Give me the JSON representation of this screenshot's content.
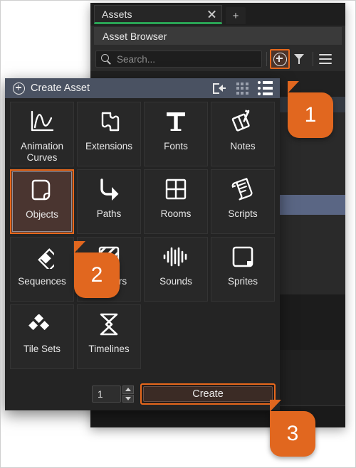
{
  "browser": {
    "tab": {
      "label": "Assets",
      "close_icon": "close-icon",
      "add_tab_label": "+"
    },
    "panel_title": "Asset Browser",
    "search": {
      "placeholder": "Search...",
      "value": ""
    },
    "toolbar": {
      "add_icon": "plus-circle-icon",
      "filter_icon": "funnel-icon",
      "menu_icon": "hamburger-icon"
    }
  },
  "dialog": {
    "title": "Create Asset",
    "title_icon": "plus-circle-icon",
    "header_icons": {
      "import": "import-icon",
      "grid_view": "grid-view-icon",
      "list_view": "list-view-icon"
    },
    "items": [
      {
        "label": "Animation Curves",
        "icon": "animation-curves-icon",
        "selected": false
      },
      {
        "label": "Extensions",
        "icon": "extensions-icon",
        "selected": false
      },
      {
        "label": "Fonts",
        "icon": "fonts-icon",
        "selected": false
      },
      {
        "label": "Notes",
        "icon": "notes-icon",
        "selected": false
      },
      {
        "label": "Objects",
        "icon": "objects-icon",
        "selected": true
      },
      {
        "label": "Paths",
        "icon": "paths-icon",
        "selected": false
      },
      {
        "label": "Rooms",
        "icon": "rooms-icon",
        "selected": false
      },
      {
        "label": "Scripts",
        "icon": "scripts-icon",
        "selected": false
      },
      {
        "label": "Sequences",
        "icon": "sequences-icon",
        "selected": false
      },
      {
        "label": "Shaders",
        "icon": "shaders-icon",
        "selected": false
      },
      {
        "label": "Sounds",
        "icon": "sounds-icon",
        "selected": false
      },
      {
        "label": "Sprites",
        "icon": "sprites-icon",
        "selected": false
      },
      {
        "label": "Tile Sets",
        "icon": "tile-sets-icon",
        "selected": false
      },
      {
        "label": "Timelines",
        "icon": "timelines-icon",
        "selected": false
      }
    ],
    "footer": {
      "quantity": "1",
      "create_label": "Create"
    }
  },
  "callouts": [
    {
      "number": "1"
    },
    {
      "number": "2"
    },
    {
      "number": "3"
    }
  ],
  "colors": {
    "accent_orange": "#e1671f",
    "tab_active_underline": "#2aa455",
    "dialog_titlebar": "#4a5262",
    "selection_row": "#5a6684"
  }
}
